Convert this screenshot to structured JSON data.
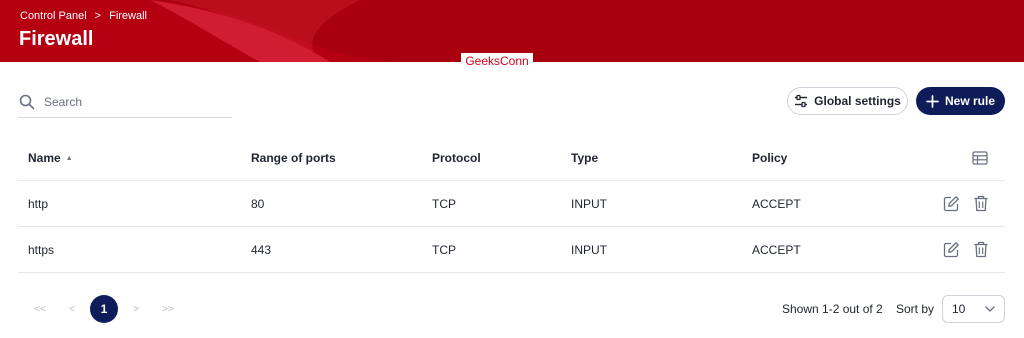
{
  "header": {
    "breadcrumb": [
      "Control Panel",
      "Firewall"
    ],
    "breadcrumb_separator": ">",
    "title": "Firewall",
    "color": "#a8000e"
  },
  "watermark": "GeeksConn",
  "search": {
    "placeholder": "Search",
    "value": ""
  },
  "toolbar": {
    "global_settings_label": "Global settings",
    "new_rule_label": "New rule",
    "accent": "#0e1d5a"
  },
  "table": {
    "columns": [
      "Name",
      "Range of ports",
      "Protocol",
      "Type",
      "Policy"
    ],
    "sort_indicator": "▲",
    "rows": [
      {
        "name": "http",
        "ports": "80",
        "protocol": "TCP",
        "type": "INPUT",
        "policy": "ACCEPT"
      },
      {
        "name": "https",
        "ports": "443",
        "protocol": "TCP",
        "type": "INPUT",
        "policy": "ACCEPT"
      }
    ]
  },
  "pagination": {
    "first": "<<",
    "prev": "<",
    "current": "1",
    "next": ">",
    "last": ">>",
    "shown_text": "Shown 1-2 out of 2",
    "sort_by_label": "Sort by",
    "page_size": "10"
  }
}
